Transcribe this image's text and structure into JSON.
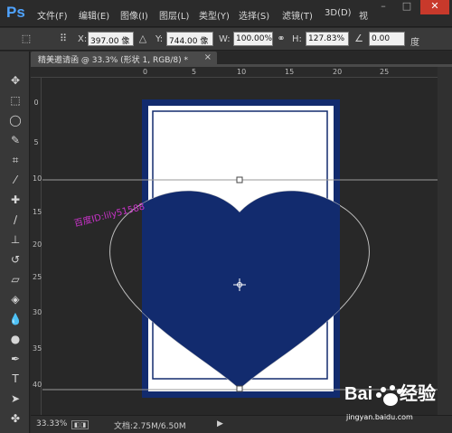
{
  "app": {
    "logo": "Ps"
  },
  "menu": [
    "文件(F)",
    "编辑(E)",
    "图像(I)",
    "图层(L)",
    "类型(Y)",
    "选择(S)",
    "滤镜(T)",
    "3D(D)",
    "视"
  ],
  "window_buttons": {
    "minimize": "–",
    "maximize": "□",
    "close": "✕"
  },
  "options": {
    "x_label": "X:",
    "x_value": "397.00 像",
    "y_label": "Y:",
    "y_value": "744.00 像",
    "w_label": "W:",
    "w_value": "100.00%",
    "h_label": "H:",
    "h_value": "127.83%",
    "angle_value": "0.00",
    "angle_unit": "度"
  },
  "document": {
    "tab_label": "精美邀请函 @ 33.3% (形状 1, RGB/8) *",
    "close": "×"
  },
  "ruler_top_ticks": [
    "0",
    "5",
    "10",
    "15",
    "20",
    "25"
  ],
  "ruler_left_ticks": [
    "0",
    "5",
    "10",
    "15",
    "20",
    "25",
    "30",
    "35",
    "40"
  ],
  "canvas": {
    "overlay_text": "百度ID:lily51588",
    "card_color": "#122b6e",
    "heart_color": "#122b6e",
    "paper_color": "#ffffff",
    "overlay_color": "#cc33cc"
  },
  "status": {
    "zoom": "33.33%",
    "doc_info": "文档:2.75M/6.50M",
    "arrow": "▶"
  },
  "watermark": {
    "brand": "Bai du 经验",
    "url": "jingyan.baidu.com"
  }
}
